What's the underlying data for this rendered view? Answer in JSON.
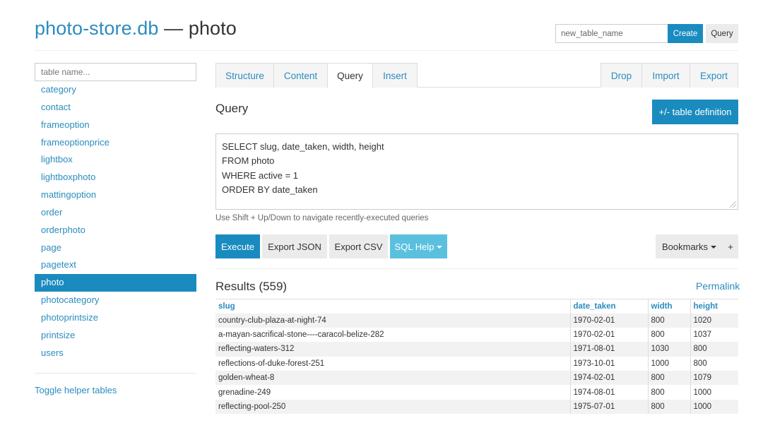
{
  "header": {
    "db_name": "photo-store.db",
    "separator": " — ",
    "table_name": "photo",
    "new_table_placeholder": "new_table_name",
    "create_label": "Create",
    "query_label": "Query"
  },
  "sidebar": {
    "filter_placeholder": "table name...",
    "tables": [
      "category",
      "contact",
      "frameoption",
      "frameoptionprice",
      "lightbox",
      "lightboxphoto",
      "mattingoption",
      "order",
      "orderphoto",
      "page",
      "pagetext",
      "photo",
      "photocategory",
      "photoprintsize",
      "printsize",
      "users"
    ],
    "active_table": "photo",
    "toggle_label": "Toggle helper tables"
  },
  "tabs": {
    "left": [
      "Structure",
      "Content",
      "Query",
      "Insert"
    ],
    "right": [
      "Drop",
      "Import",
      "Export"
    ],
    "active": "Query"
  },
  "query": {
    "heading": "Query",
    "table_def_label": "+/- table definition",
    "sql_lines": [
      "SELECT slug, date_taken, width, height",
      "FROM photo",
      "WHERE active = 1",
      "ORDER BY date_taken"
    ],
    "hint": "Use Shift + Up/Down to navigate recently-executed queries"
  },
  "toolbar": {
    "execute_label": "Execute",
    "export_json_label": "Export JSON",
    "export_csv_label": "Export CSV",
    "sql_help_label": "SQL Help",
    "bookmarks_label": "Bookmarks",
    "plus_label": "+"
  },
  "results": {
    "heading": "Results (559)",
    "permalink_label": "Permalink",
    "columns": [
      "slug",
      "date_taken",
      "width",
      "height"
    ],
    "rows": [
      [
        "country-club-plaza-at-night-74",
        "1970-02-01",
        "800",
        "1020"
      ],
      [
        "a-mayan-sacrifical-stone----caracol-belize-282",
        "1970-02-01",
        "800",
        "1037"
      ],
      [
        "reflecting-waters-312",
        "1971-08-01",
        "1030",
        "800"
      ],
      [
        "reflections-of-duke-forest-251",
        "1973-10-01",
        "1000",
        "800"
      ],
      [
        "golden-wheat-8",
        "1974-02-01",
        "800",
        "1079"
      ],
      [
        "grenadine-249",
        "1974-08-01",
        "800",
        "1000"
      ],
      [
        "reflecting-pool-250",
        "1975-07-01",
        "800",
        "1000"
      ]
    ]
  },
  "colors": {
    "accent": "#1a8bbf",
    "link": "#2b8cbe",
    "info": "#5bc0de"
  }
}
